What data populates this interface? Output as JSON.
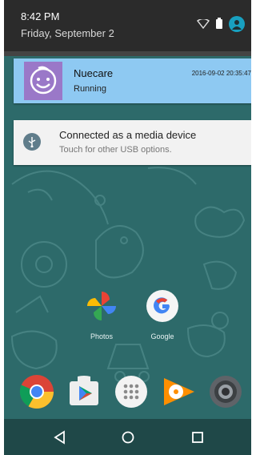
{
  "status_bar": {
    "time": "8:42 PM",
    "date": "Friday, September 2"
  },
  "notifications": [
    {
      "app": "Nuecare",
      "status": "Running",
      "timestamp": "2016-09-02 20:35:47",
      "accent": "#8ec9f2",
      "icon": "smiley-baby-icon"
    },
    {
      "title": "Connected as a media device",
      "subtitle": "Touch for other USB options.",
      "icon": "usb-icon"
    }
  ],
  "home_shortcuts": [
    {
      "label": "Photos",
      "icon": "photos-icon"
    },
    {
      "label": "Google",
      "icon": "google-icon"
    }
  ],
  "dock": [
    {
      "icon": "chrome-icon"
    },
    {
      "icon": "play-store-icon"
    },
    {
      "icon": "app-drawer-icon"
    },
    {
      "icon": "play-music-icon"
    },
    {
      "icon": "camera-icon"
    }
  ],
  "nav": [
    "back-icon",
    "home-icon",
    "recents-icon"
  ],
  "colors": {
    "wallpaper": "#2d6a6a",
    "shade": "#2b2b2b"
  }
}
